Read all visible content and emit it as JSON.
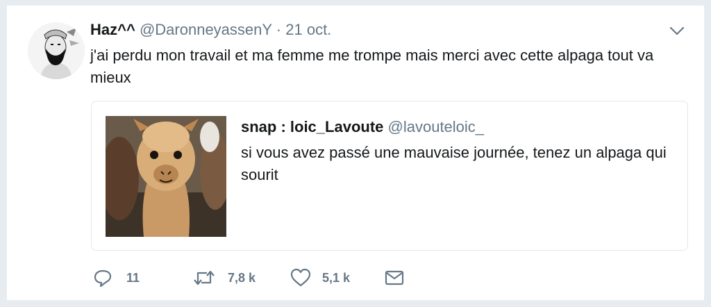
{
  "tweet": {
    "name": "Haz^^",
    "handle": "@DaronneyassenY",
    "separator": "·",
    "date": "21 oct.",
    "text": "j'ai perdu mon travail et ma femme me trompe mais merci avec cette alpaga tout va mieux",
    "avatar_icon": "cartoon-bearded-man-avatar"
  },
  "quoted": {
    "name": "snap : loic_Lavoute",
    "handle": "@lavouteloic_",
    "text": "si vous avez passé une mauvaise journée, tenez un alpaga qui sourit",
    "image_subject": "smiling-alpaca-photo"
  },
  "actions": {
    "reply": {
      "icon": "reply-icon",
      "count": "11"
    },
    "retweet": {
      "icon": "retweet-icon",
      "count": "7,8 k"
    },
    "like": {
      "icon": "heart-icon",
      "count": "5,1 k"
    },
    "dm": {
      "icon": "envelope-icon"
    }
  },
  "colors": {
    "text": "#14171a",
    "secondary": "#657786",
    "border": "#e1e8ed",
    "background": "#e6ecf0"
  }
}
